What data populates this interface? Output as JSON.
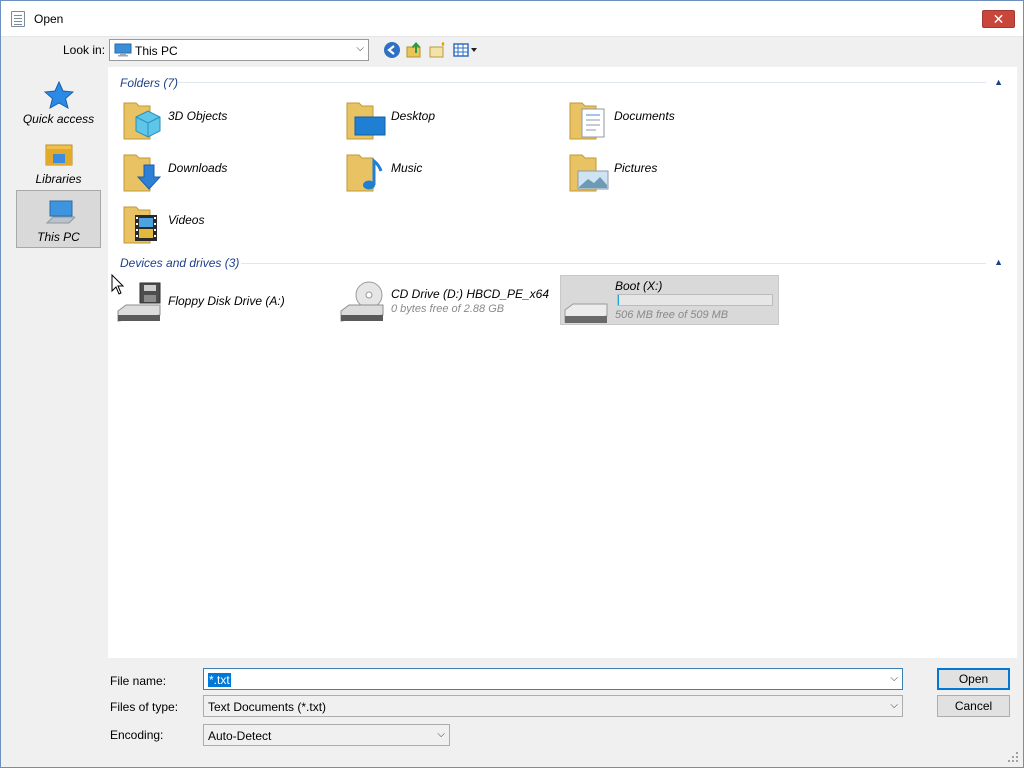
{
  "window": {
    "title": "Open"
  },
  "toolbar": {
    "look_in_label": "Look in:",
    "look_in_value": "This PC"
  },
  "sidebar": {
    "items": [
      {
        "label": "Quick access",
        "icon": "star-icon",
        "selected": false
      },
      {
        "label": "Libraries",
        "icon": "libraries-icon",
        "selected": false
      },
      {
        "label": "This PC",
        "icon": "computer-icon",
        "selected": true
      }
    ]
  },
  "folders": {
    "header": "Folders (7)",
    "items": [
      {
        "name": "3D Objects",
        "icon": "3d-objects-folder-icon"
      },
      {
        "name": "Desktop",
        "icon": "desktop-folder-icon"
      },
      {
        "name": "Documents",
        "icon": "documents-folder-icon"
      },
      {
        "name": "Downloads",
        "icon": "downloads-folder-icon"
      },
      {
        "name": "Music",
        "icon": "music-folder-icon"
      },
      {
        "name": "Pictures",
        "icon": "pictures-folder-icon"
      },
      {
        "name": "Videos",
        "icon": "videos-folder-icon"
      }
    ]
  },
  "devices": {
    "header": "Devices and drives (3)",
    "items": [
      {
        "name": "Floppy Disk Drive (A:)",
        "detail": "",
        "icon": "floppy-drive-icon",
        "selected": false
      },
      {
        "name": "CD Drive (D:) HBCD_PE_x64",
        "detail": "0 bytes free of 2.88 GB",
        "icon": "cd-drive-icon",
        "selected": false
      },
      {
        "name": "Boot (X:)",
        "detail": "506 MB free of 509 MB",
        "icon": "hard-drive-icon",
        "selected": true,
        "used_fraction": 0.006
      }
    ]
  },
  "form": {
    "file_name_label": "File name:",
    "file_name_value": "*.txt",
    "files_of_type_label": "Files of type:",
    "files_of_type_value": "Text Documents (*.txt)",
    "encoding_label": "Encoding:",
    "encoding_value": "Auto-Detect",
    "open_label": "Open",
    "cancel_label": "Cancel"
  },
  "colors": {
    "accent": "#0078d7",
    "group_header": "#1e3f8a",
    "close_button": "#c9463d"
  }
}
